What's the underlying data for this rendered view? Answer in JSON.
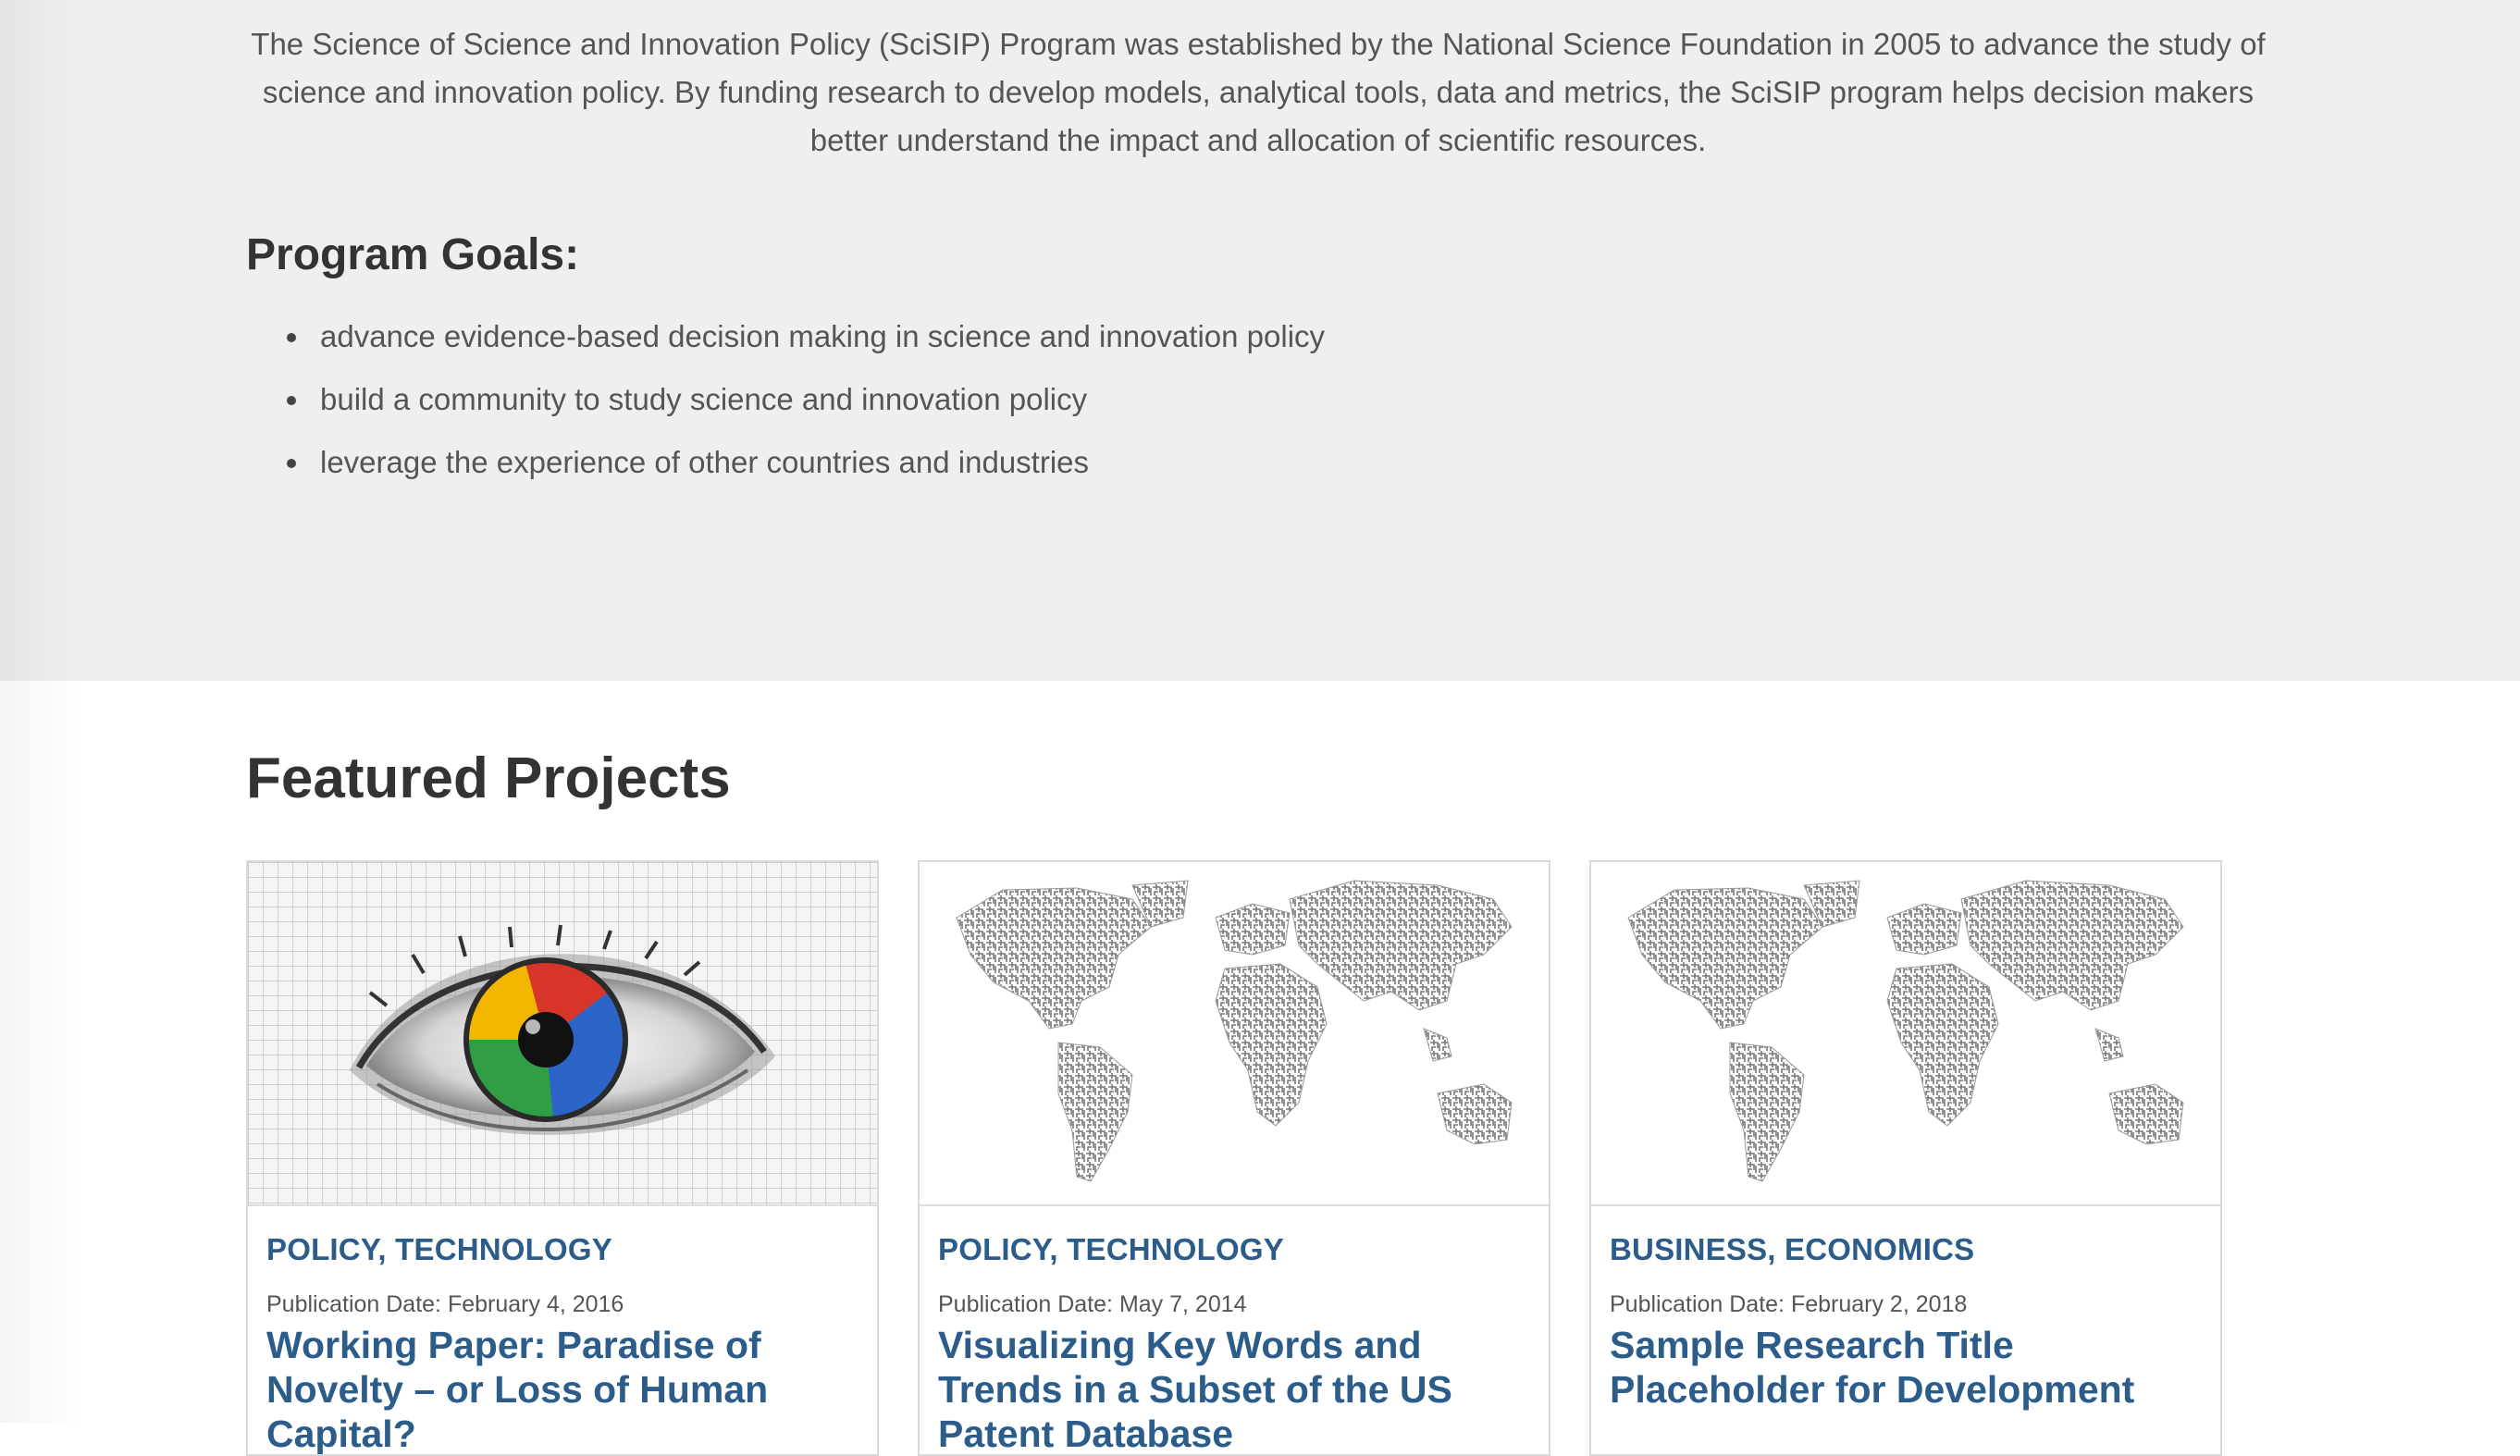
{
  "intro": {
    "text": "The Science of Science and Innovation Policy (SciSIP) Program was established by the National Science Foundation in 2005 to advance the study of science and innovation policy. By funding research to develop models, analytical tools, data and metrics, the SciSIP program helps decision makers better understand the impact and allocation of scientific resources."
  },
  "goals": {
    "title": "Program Goals:",
    "items": [
      "advance evidence-based decision making in science and innovation policy",
      "build a community to study science and innovation policy",
      "leverage the experience of other countries and industries"
    ]
  },
  "featured": {
    "title": "Featured Projects",
    "cards": [
      {
        "image": "eye-grid-image",
        "tags": "POLICY, TECHNOLOGY",
        "date": "Publication Date: February 4, 2016",
        "title": "Working Paper: Paradise of Novelty – or Loss of Human Capital?"
      },
      {
        "image": "world-map-image",
        "tags": "POLICY, TECHNOLOGY",
        "date": "Publication Date: May 7, 2014",
        "title": "Visualizing Key Words and Trends in a Subset of the US Patent Database"
      },
      {
        "image": "world-map-image",
        "tags": "BUSINESS, ECONOMICS",
        "date": "Publication Date: February 2, 2018",
        "title": "Sample Research Title Placeholder for Development"
      }
    ]
  },
  "colors": {
    "intro_bg": "#efefef",
    "link_blue": "#2b5c8a",
    "heading": "#333333"
  }
}
